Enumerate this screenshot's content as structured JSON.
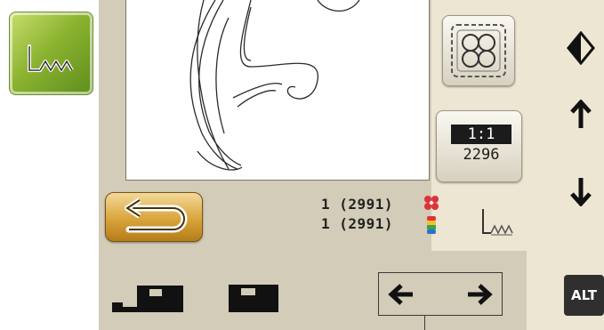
{
  "stitch_button": {
    "icon": "stitch-pattern-icon"
  },
  "canvas": {
    "content": "embroidery-design-preview"
  },
  "layout_button": {
    "icon": "hoop-layout-icon"
  },
  "scale_button": {
    "ratio": "1:1",
    "stitches": "2296"
  },
  "back_button": {
    "icon": "return-arrow-icon"
  },
  "counters": {
    "design_count": "1 (2991)",
    "color_count": "1 (2991)"
  },
  "colors": {
    "panel": "#d2ccb8",
    "side": "#ede6d2",
    "accent_green": "#8cb431",
    "accent_orange": "#d9a43a",
    "flower_red": "#e0303a"
  },
  "right_bar": {
    "mirror_icon": "mirror-flip-icon",
    "up_icon": "arrow-up-icon",
    "down_icon": "arrow-down-icon",
    "alt_label": "ALT"
  },
  "bottom_bar": {
    "left_arrow": "arrow-left-icon",
    "right_arrow": "arrow-right-icon"
  }
}
